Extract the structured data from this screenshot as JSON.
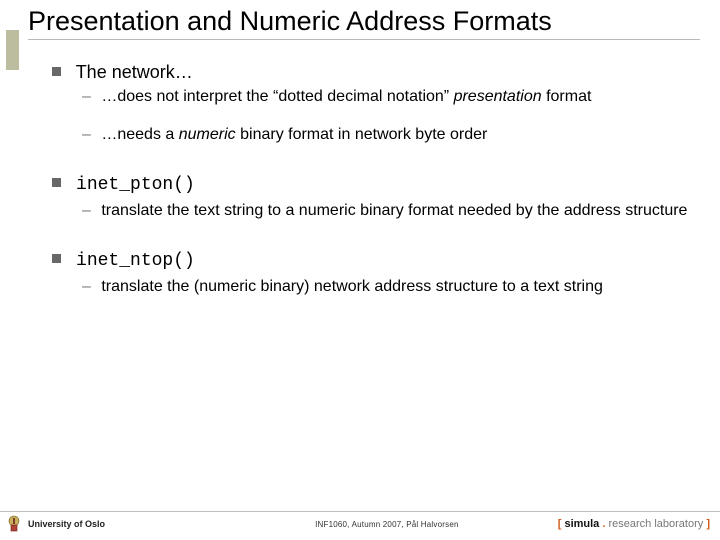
{
  "title": "Presentation and Numeric Address Formats",
  "items": [
    {
      "text": "The network…",
      "code": false,
      "subs": [
        {
          "prefix": "…does not interpret the “dotted decimal notation” ",
          "em": "presentation",
          "suffix": " format"
        },
        {
          "prefix": "…needs a ",
          "em": "numeric",
          "suffix": " binary format in network byte order"
        }
      ]
    },
    {
      "text": "inet_pton()",
      "code": true,
      "subs": [
        {
          "prefix": "translate the text string to a numeric binary format needed by the address structure",
          "em": "",
          "suffix": ""
        }
      ]
    },
    {
      "text": "inet_ntop()",
      "code": true,
      "subs": [
        {
          "prefix": "translate the (numeric binary) network address structure to a text string",
          "em": "",
          "suffix": ""
        }
      ]
    }
  ],
  "footer": {
    "left": "University of Oslo",
    "center": "INF1060, Autumn 2007, Pål Halvorsen",
    "simula": {
      "open": "[ ",
      "word": "simula",
      "dot": " . ",
      "rest": "research laboratory",
      "close": " ]"
    }
  }
}
